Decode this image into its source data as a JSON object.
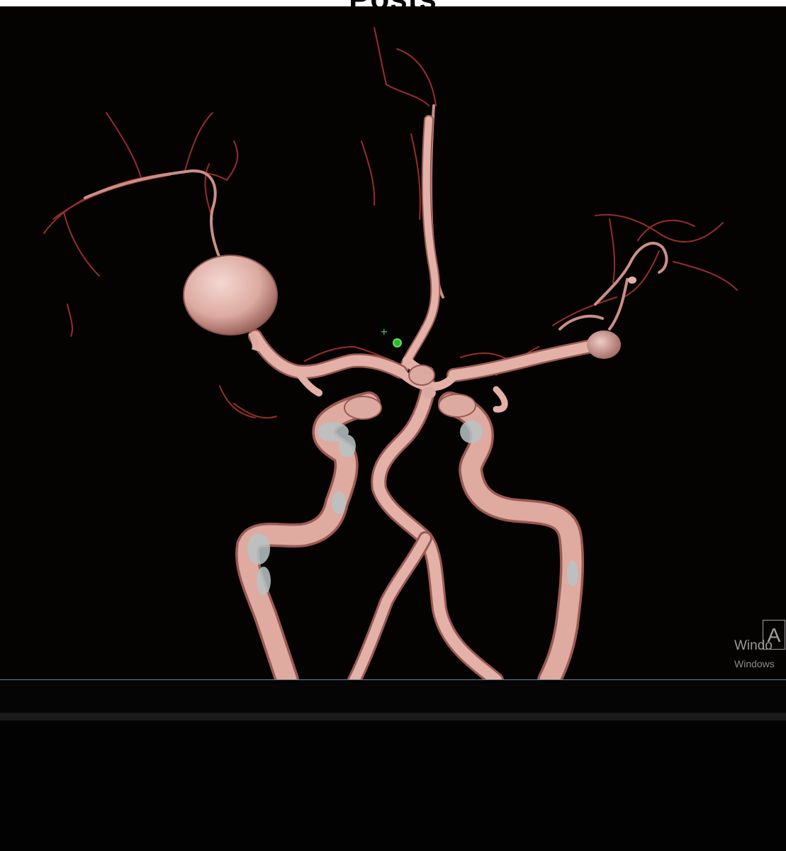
{
  "header": {
    "title": "Posts"
  },
  "viewport": {
    "description_colors": {
      "vessel": "#e8b5ac",
      "vessel_shadow": "#9a5a52",
      "small_vessel": "#a8332a",
      "calcification": "#b9c4c6",
      "background": "#050202"
    },
    "markers": {
      "crosshair": "+",
      "crosshair_color": "#3fbf3f",
      "target_color": "#2fb52f"
    }
  },
  "watermark": {
    "line1": "Windo",
    "line2": "Windows",
    "box_letter": "A"
  }
}
